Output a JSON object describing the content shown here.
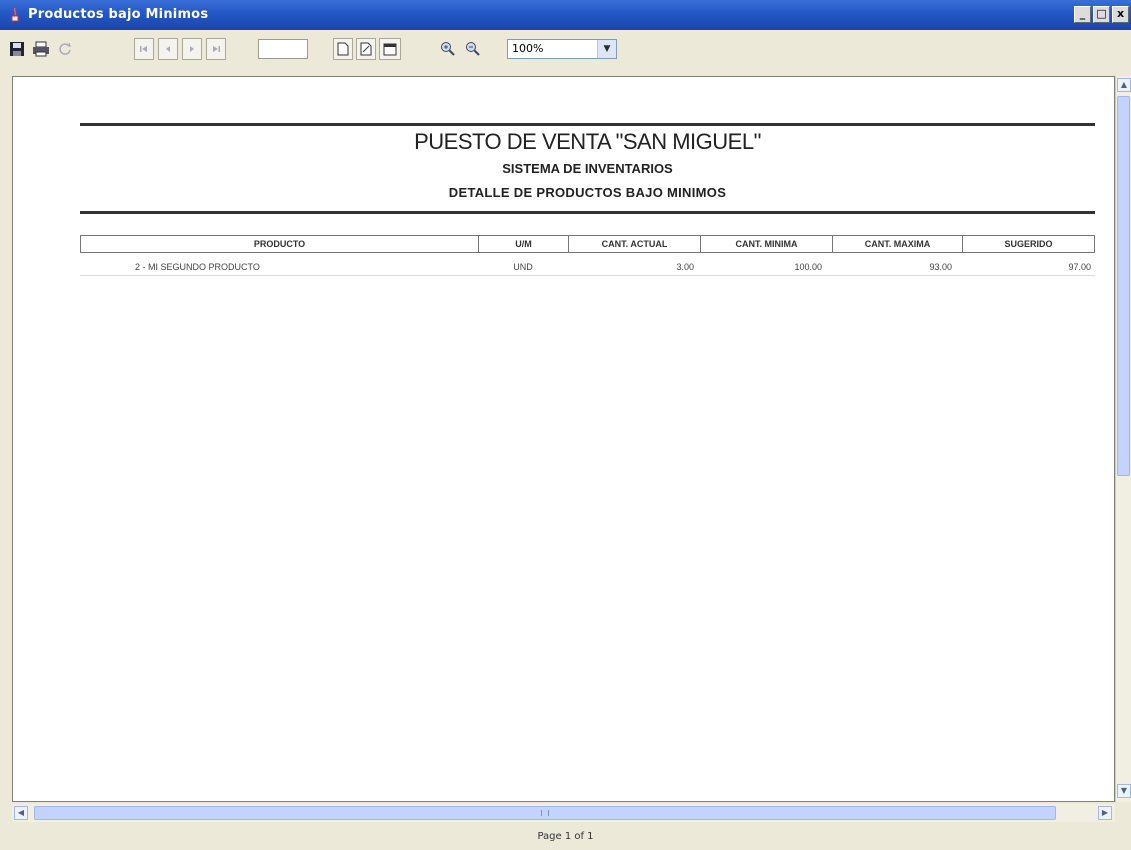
{
  "window": {
    "title": "Productos bajo Minimos"
  },
  "toolbar": {
    "zoom": "100%",
    "page_input": ""
  },
  "report": {
    "title": "PUESTO DE VENTA \"SAN MIGUEL\"",
    "subtitle": "SISTEMA DE INVENTARIOS",
    "heading": "DETALLE DE PRODUCTOS BAJO MINIMOS",
    "columns": [
      "PRODUCTO",
      "U/M",
      "CANT. ACTUAL",
      "CANT. MINIMA",
      "CANT. MAXIMA",
      "SUGERIDO"
    ],
    "rows": [
      {
        "producto": "2 - MI SEGUNDO PRODUCTO",
        "um": "UND",
        "actual": "3.00",
        "minima": "100.00",
        "maxima": "93.00",
        "sugerido": "97.00"
      }
    ]
  },
  "status": {
    "page": "Page 1 of 1"
  },
  "colors": {
    "titlebar": "#2357c6",
    "chrome": "#ece9d8",
    "scrollbar_thumb": "#c3d3fd"
  }
}
